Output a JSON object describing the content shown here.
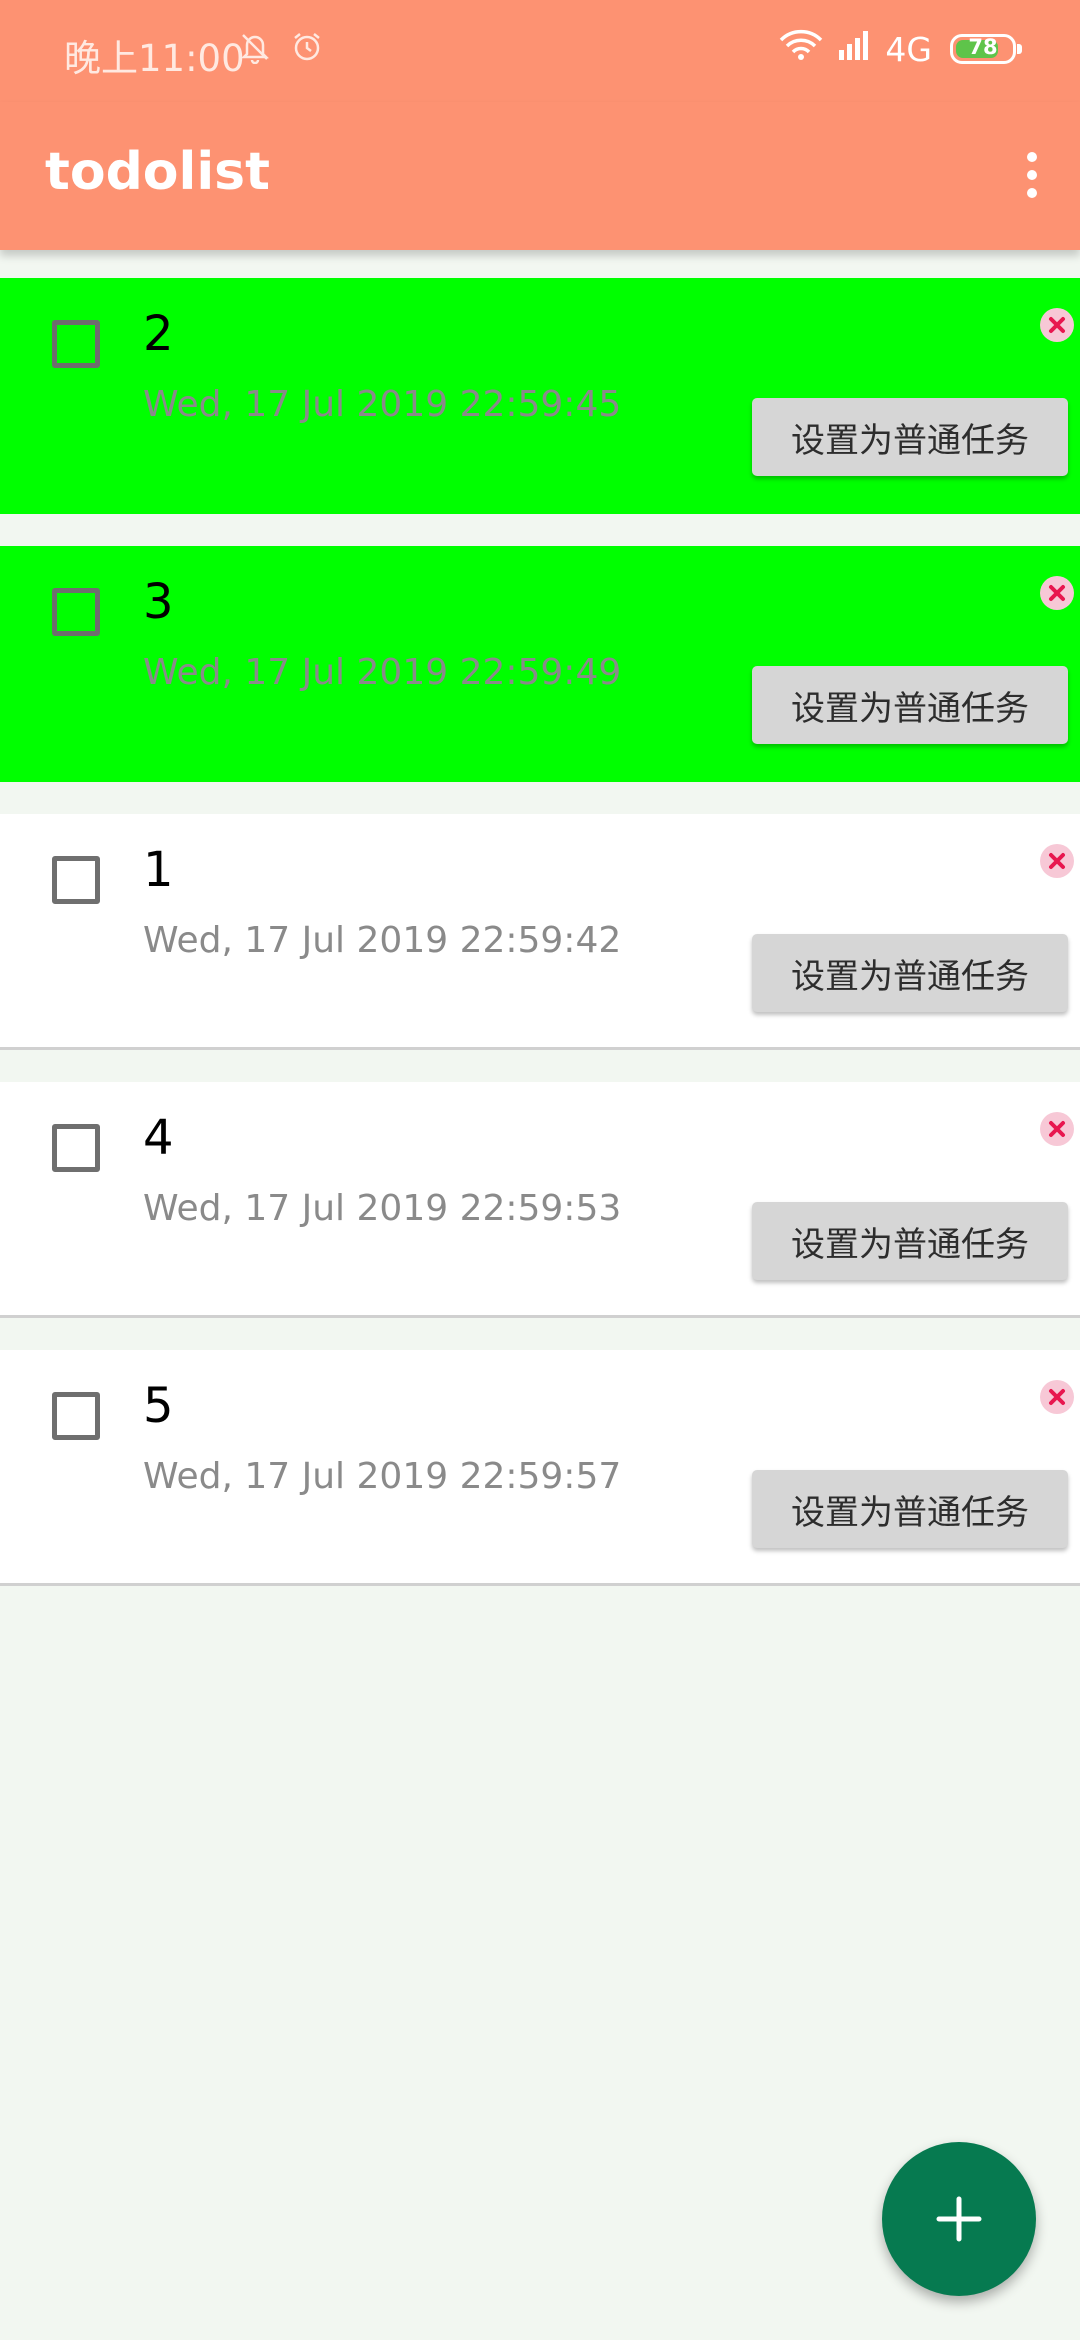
{
  "status_bar": {
    "time": "晚上11:00",
    "network": "4G",
    "battery": "78",
    "battery_level_percent": 78
  },
  "app_bar": {
    "title": "todolist"
  },
  "tasks": [
    {
      "title": "2",
      "time": "Wed, 17 Jul 2019 22:59:45",
      "button_label": "设置为普通任务",
      "highlight": true
    },
    {
      "title": "3",
      "time": "Wed, 17 Jul 2019 22:59:49",
      "button_label": "设置为普通任务",
      "highlight": true
    },
    {
      "title": "1",
      "time": "Wed, 17 Jul 2019 22:59:42",
      "button_label": "设置为普通任务",
      "highlight": false
    },
    {
      "title": "4",
      "time": "Wed, 17 Jul 2019 22:59:53",
      "button_label": "设置为普通任务",
      "highlight": false
    },
    {
      "title": "5",
      "time": "Wed, 17 Jul 2019 22:59:57",
      "button_label": "设置为普通任务",
      "highlight": false
    }
  ],
  "colors": {
    "app_bar": "#fd9272",
    "highlight": "#00ff00",
    "normal": "#ffffff",
    "fab": "#067a50",
    "background": "#f2f7f1"
  },
  "icons": {
    "overflow": "more-vert-icon",
    "delete": "close-circle-icon",
    "add": "plus-icon"
  }
}
